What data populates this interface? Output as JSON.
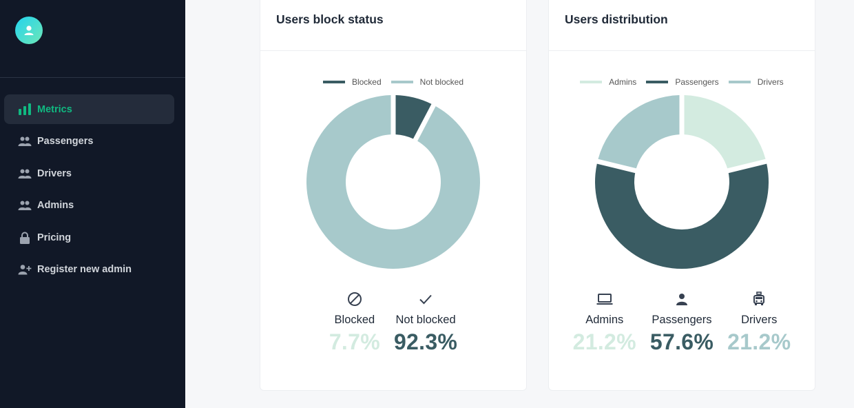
{
  "sidebar": {
    "items": [
      {
        "label": "Metrics",
        "icon": "bar-chart-icon",
        "active": true
      },
      {
        "label": "Passengers",
        "icon": "users-icon"
      },
      {
        "label": "Drivers",
        "icon": "users-icon"
      },
      {
        "label": "Admins",
        "icon": "users-icon"
      },
      {
        "label": "Pricing",
        "icon": "lock-icon"
      },
      {
        "label": "Register new admin",
        "icon": "user-plus-icon"
      }
    ]
  },
  "colors": {
    "dark": "#3a5c63",
    "light": "#a7c9cb",
    "pale": "#d3ebe0",
    "accent": "#10b981"
  },
  "block_status": {
    "title": "Users block status",
    "legend": [
      "Blocked",
      "Not blocked"
    ],
    "stats": [
      {
        "label": "Blocked",
        "value": "7.7%",
        "icon": "block-icon"
      },
      {
        "label": "Not blocked",
        "value": "92.3%",
        "icon": "check-icon"
      }
    ]
  },
  "distribution": {
    "title": "Users distribution",
    "legend": [
      "Admins",
      "Passengers",
      "Drivers"
    ],
    "stats": [
      {
        "label": "Admins",
        "value": "21.2%",
        "icon": "laptop-icon"
      },
      {
        "label": "Passengers",
        "value": "57.6%",
        "icon": "person-icon"
      },
      {
        "label": "Drivers",
        "value": "21.2%",
        "icon": "car-icon"
      }
    ]
  },
  "chart_data": [
    {
      "type": "pie",
      "title": "Users block status",
      "categories": [
        "Blocked",
        "Not blocked"
      ],
      "values": [
        7.7,
        92.3
      ],
      "colors": [
        "#3a5c63",
        "#a7c9cb"
      ],
      "legend": "top"
    },
    {
      "type": "pie",
      "title": "Users distribution",
      "categories": [
        "Admins",
        "Passengers",
        "Drivers"
      ],
      "values": [
        21.2,
        57.6,
        21.2
      ],
      "colors": [
        "#d3ebe0",
        "#3a5c63",
        "#a7c9cb"
      ],
      "legend": "top"
    }
  ]
}
